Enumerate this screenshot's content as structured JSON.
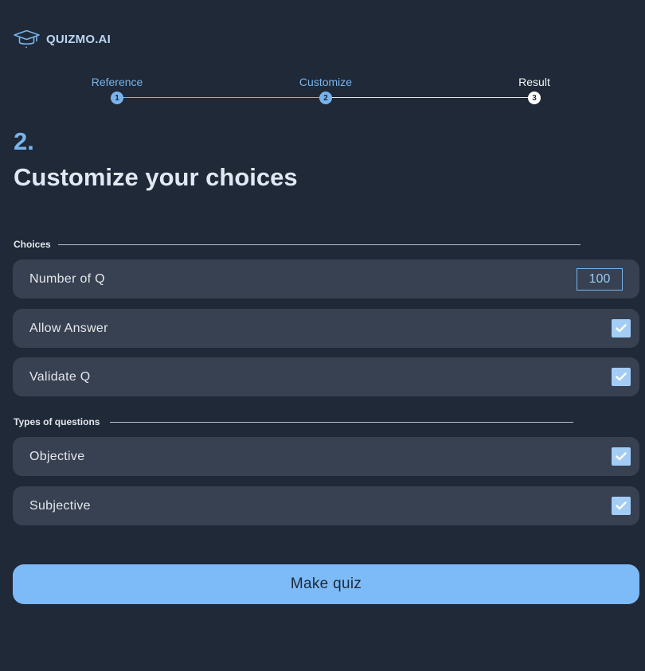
{
  "app": {
    "brand": "QUIZMO.AI",
    "logo_icon": "graduation-cap-icon"
  },
  "stepper": {
    "steps": [
      {
        "label": "Reference",
        "number": "1",
        "state": "done"
      },
      {
        "label": "Customize",
        "number": "2",
        "state": "current"
      },
      {
        "label": "Result",
        "number": "3",
        "state": "todo"
      }
    ]
  },
  "header": {
    "step_number": "2.",
    "title": "Customize your choices"
  },
  "sections": {
    "choices": {
      "label": "Choices",
      "number_of_q": {
        "label": "Number of Q",
        "value": "100"
      },
      "allow_answer": {
        "label": "Allow Answer",
        "checked": true
      },
      "validate_q": {
        "label": "Validate Q",
        "checked": true
      }
    },
    "types": {
      "label": "Types of questions",
      "objective": {
        "label": "Objective",
        "checked": true
      },
      "subjective": {
        "label": "Subjective",
        "checked": true
      }
    }
  },
  "actions": {
    "make_quiz": "Make quiz"
  },
  "colors": {
    "background": "#1f2937",
    "row": "#374151",
    "accent": "#79b4ec",
    "checkbox": "#a3cdf5",
    "button": "#7dbbf8"
  }
}
